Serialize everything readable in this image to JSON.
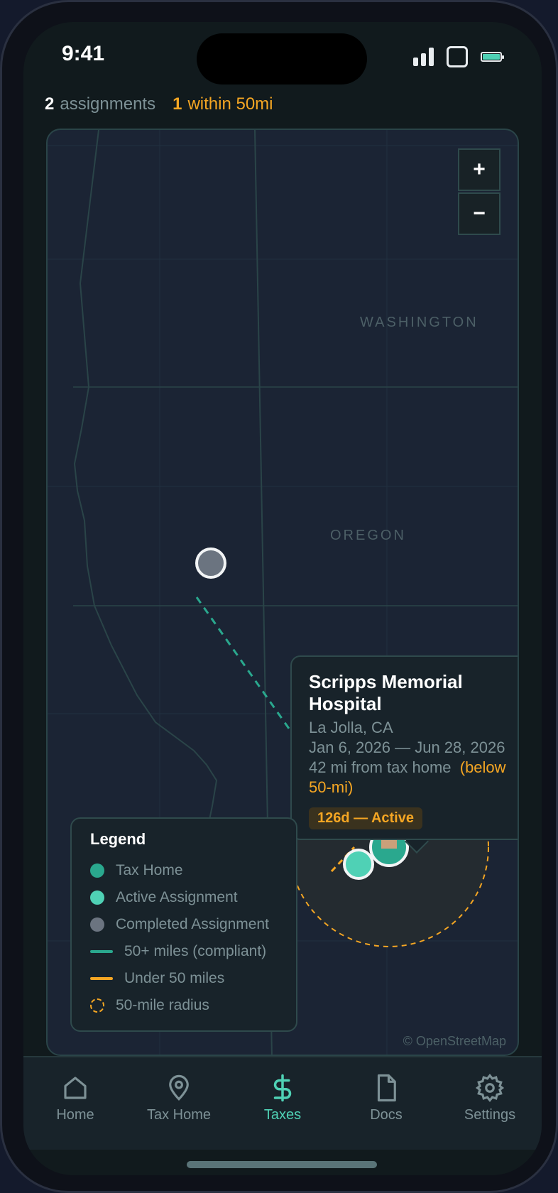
{
  "status": {
    "time": "9:41"
  },
  "summary": {
    "total_count": "2",
    "total_label": "assignments",
    "near_count": "1",
    "near_label": "within 50mi"
  },
  "map": {
    "zoom_in": "+",
    "zoom_out": "−",
    "regions": [
      "WASHINGTON",
      "OREGON"
    ],
    "attribution": "© OpenStreetMap"
  },
  "popup": {
    "title": "Scripps Memorial Hospital",
    "location": "La Jolla, CA",
    "dates": "Jan 6, 2026 — Jun 28, 2026",
    "distance": "42 mi from tax home",
    "warning": "(below 50-mi)",
    "badge": "126d — Active"
  },
  "legend": {
    "title": "Legend",
    "items": [
      {
        "label": "Tax Home",
        "kind": "dot",
        "color": "#2aa88e"
      },
      {
        "label": "Active Assignment",
        "kind": "dot",
        "color": "#4fd1b5"
      },
      {
        "label": "Completed Assignment",
        "kind": "dot",
        "color": "#6b7480"
      },
      {
        "label": "50+ miles (compliant)",
        "kind": "line",
        "color": "#2aa88e"
      },
      {
        "label": "Under 50 miles",
        "kind": "line",
        "color": "#f5a623"
      },
      {
        "label": "50-mile radius",
        "kind": "ring",
        "color": "#f5a623"
      }
    ]
  },
  "tabs": [
    {
      "label": "Home",
      "icon": "house-icon",
      "active": false
    },
    {
      "label": "Tax Home",
      "icon": "map-pin-icon",
      "active": false
    },
    {
      "label": "Taxes",
      "icon": "dollar-icon",
      "active": true
    },
    {
      "label": "Docs",
      "icon": "document-icon",
      "active": false
    },
    {
      "label": "Settings",
      "icon": "gear-icon",
      "active": false
    }
  ],
  "colors": {
    "accent": "#4fd1b5",
    "warning": "#f5a623",
    "completed": "#6b7480"
  }
}
